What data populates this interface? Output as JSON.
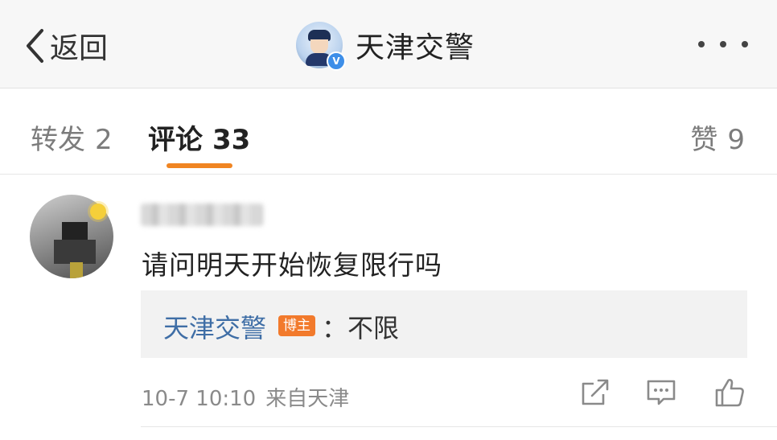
{
  "header": {
    "back_label": "返回",
    "title": "天津交警",
    "verified_mark": "V"
  },
  "tabs": [
    {
      "label": "转发",
      "count": "2"
    },
    {
      "label": "评论",
      "count": "33"
    },
    {
      "label": "赞",
      "count": "9"
    }
  ],
  "colors": {
    "accent_orange": "#f08522",
    "author_badge": "#f27a2c",
    "link_blue": "#3f6ea6",
    "verified_blue": "#3d8ee8"
  },
  "comment": {
    "text": "请问明天开始恢复限行吗",
    "reply": {
      "author": "天津交警",
      "badge": "博主",
      "text": "：不限"
    },
    "time": "10-7 10:10",
    "source": "来自天津"
  },
  "icons": {
    "back": "chevron-left-icon",
    "more": "more-dots-icon",
    "share": "share-icon",
    "comment": "comment-icon",
    "like": "thumbs-up-icon"
  }
}
